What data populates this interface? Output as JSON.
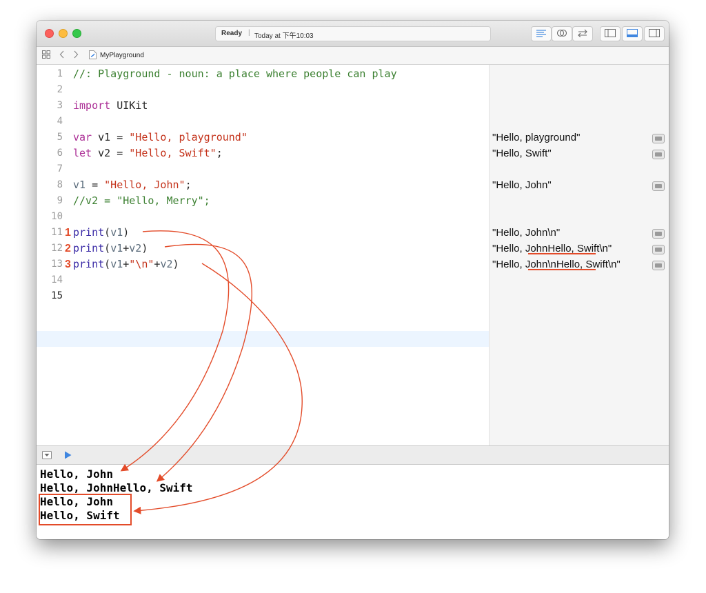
{
  "titlebar": {
    "status": "Ready",
    "separator": "|",
    "time": "Today at 下午10:03",
    "buttons": [
      "standard-editor-icon",
      "assistant-editor-icon",
      "version-editor-icon",
      "navigator-panel-icon",
      "debug-area-icon",
      "utilities-panel-icon"
    ]
  },
  "nav": {
    "file_name": "MyPlayground"
  },
  "editor": {
    "lines": [
      {
        "num": "1",
        "tokens": [
          {
            "t": "//: Playground - noun: a place where people can play",
            "c": "cm"
          }
        ]
      },
      {
        "num": "2",
        "tokens": []
      },
      {
        "num": "3",
        "tokens": [
          {
            "t": "import",
            "c": "kw"
          },
          {
            "t": " UIKit",
            "c": ""
          }
        ]
      },
      {
        "num": "4",
        "tokens": []
      },
      {
        "num": "5",
        "tokens": [
          {
            "t": "var",
            "c": "kw"
          },
          {
            "t": " v1 = ",
            "c": ""
          },
          {
            "t": "\"Hello, playground\"",
            "c": "st"
          }
        ]
      },
      {
        "num": "6",
        "tokens": [
          {
            "t": "let",
            "c": "kw"
          },
          {
            "t": " v2 = ",
            "c": ""
          },
          {
            "t": "\"Hello, Swift\"",
            "c": "st"
          },
          {
            "t": ";",
            "c": ""
          }
        ]
      },
      {
        "num": "7",
        "tokens": []
      },
      {
        "num": "8",
        "tokens": [
          {
            "t": "v1",
            "c": "vr"
          },
          {
            "t": " = ",
            "c": ""
          },
          {
            "t": "\"Hello, John\"",
            "c": "st"
          },
          {
            "t": ";",
            "c": ""
          }
        ]
      },
      {
        "num": "9",
        "tokens": [
          {
            "t": "//v2 = \"Hello, Merry\";",
            "c": "cm"
          }
        ]
      },
      {
        "num": "10",
        "tokens": []
      },
      {
        "num": "11",
        "marker": "1",
        "tokens": [
          {
            "t": "print",
            "c": "fn"
          },
          {
            "t": "(",
            "c": ""
          },
          {
            "t": "v1",
            "c": "vr"
          },
          {
            "t": ")",
            "c": ""
          }
        ]
      },
      {
        "num": "12",
        "marker": "2",
        "tokens": [
          {
            "t": "print",
            "c": "fn"
          },
          {
            "t": "(",
            "c": ""
          },
          {
            "t": "v1",
            "c": "vr"
          },
          {
            "t": "+",
            "c": ""
          },
          {
            "t": "v2",
            "c": "vr"
          },
          {
            "t": ")",
            "c": ""
          }
        ]
      },
      {
        "num": "13",
        "marker": "3",
        "tokens": [
          {
            "t": "print",
            "c": "fn"
          },
          {
            "t": "(",
            "c": ""
          },
          {
            "t": "v1",
            "c": "vr"
          },
          {
            "t": "+",
            "c": ""
          },
          {
            "t": "\"\\n\"",
            "c": "st"
          },
          {
            "t": "+",
            "c": ""
          },
          {
            "t": "v2",
            "c": "vr"
          },
          {
            "t": ")",
            "c": ""
          }
        ]
      },
      {
        "num": "14",
        "tokens": []
      },
      {
        "num": "15",
        "current": true,
        "tokens": []
      }
    ]
  },
  "results": [
    {
      "line": 5,
      "text": "\"Hello, playground\""
    },
    {
      "line": 6,
      "text": "\"Hello, Swift\""
    },
    {
      "line": 8,
      "text": "\"Hello, John\""
    },
    {
      "line": 11,
      "text": "\"Hello, John\\n\""
    },
    {
      "line": 12,
      "text": "\"Hello, JohnHello, Swift\\n\""
    },
    {
      "line": 13,
      "text": "\"Hello, John\\nHello, Swift\\n\""
    }
  ],
  "console": {
    "lines": [
      "Hello, John",
      "Hello, JohnHello, Swift",
      "Hello, John",
      "Hello, Swift"
    ]
  },
  "colors": {
    "annotation": "#e34b29",
    "keyword": "#ab2d95",
    "string": "#c4321a",
    "comment": "#3a7f2f",
    "function": "#3a2aa6"
  }
}
